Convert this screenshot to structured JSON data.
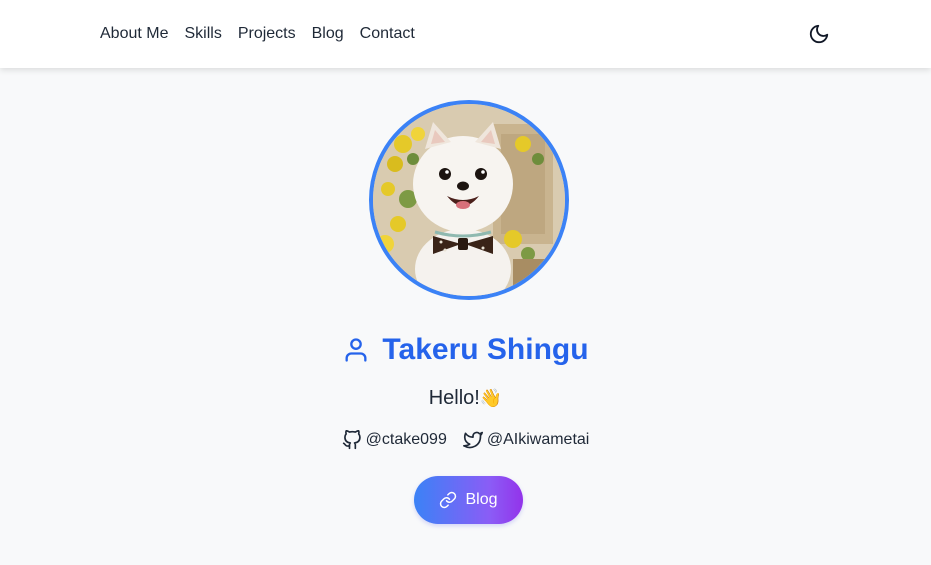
{
  "nav": {
    "items": [
      {
        "label": "About Me"
      },
      {
        "label": "Skills"
      },
      {
        "label": "Projects"
      },
      {
        "label": "Blog"
      },
      {
        "label": "Contact"
      }
    ],
    "theme_toggle_icon": "moon-icon"
  },
  "profile": {
    "avatar_icon": "dog-photo",
    "name_icon": "user-icon",
    "name": "Takeru Shingu",
    "greeting": "Hello!",
    "greeting_emoji": "👋",
    "accent_color": "#2563eb",
    "border_color": "#3b82f6"
  },
  "socials": [
    {
      "icon": "github-icon",
      "handle": "@ctake099"
    },
    {
      "icon": "twitter-icon",
      "handle": "@AIkiwametai"
    }
  ],
  "cta": {
    "label": "Blog",
    "icon": "link-icon",
    "gradient_start": "#3b82f6",
    "gradient_end": "#9333ea"
  }
}
